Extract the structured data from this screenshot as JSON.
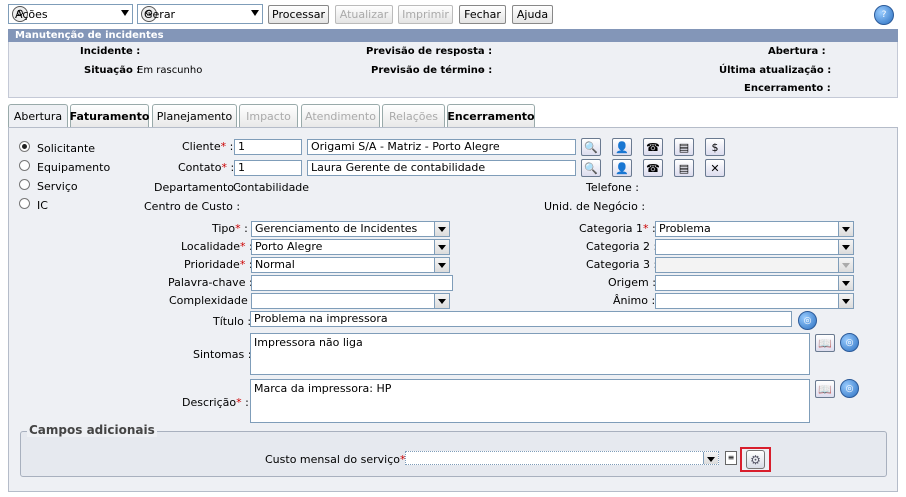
{
  "toolbar": {
    "acoes_label": "Ações",
    "gerar_label": "Gerar",
    "processar_label": "Processar",
    "atualizar_label": "Atualizar",
    "imprimir_label": "Imprimir",
    "fechar_label": "Fechar",
    "ajuda_label": "Ajuda"
  },
  "panel": {
    "title": "Manutenção de incidentes",
    "incidente_label": "Incidente :",
    "situacao_label": "Situação :",
    "situacao_value": "Em rascunho",
    "previsao_resposta_label": "Previsão de resposta :",
    "previsao_resposta_value": "-",
    "previsao_termino_label": "Previsão de término :",
    "previsao_termino_value": "-",
    "abertura_label": "Abertura :",
    "ultima_atualizacao_label": "Última atualização :",
    "encerramento_label": "Encerramento :"
  },
  "tabs": [
    {
      "label": "Abertura"
    },
    {
      "label": "Faturamento"
    },
    {
      "label": "Planejamento"
    },
    {
      "label": "Impacto"
    },
    {
      "label": "Atendimento"
    },
    {
      "label": "Relações"
    },
    {
      "label": "Encerramento"
    }
  ],
  "radios": [
    {
      "label": "Solicitante"
    },
    {
      "label": "Equipamento"
    },
    {
      "label": "Serviço"
    },
    {
      "label": "IC"
    }
  ],
  "form": {
    "cliente_label": "Cliente",
    "cliente_code": "1",
    "cliente_name": "Origami S/A - Matriz - Porto Alegre",
    "contato_label": "Contato",
    "contato_code": "1",
    "contato_name": "Laura Gerente de contabilidade",
    "departamento_label": "Departamento :",
    "departamento_value": "Contabilidade",
    "centro_custo_label": "Centro de Custo :",
    "telefone_label": "Telefone :",
    "unid_negocio_label": "Unid. de Negócio :",
    "tipo_label": "Tipo",
    "tipo_value": "Gerenciamento de Incidentes",
    "localidade_label": "Localidade",
    "localidade_value": "Porto Alegre",
    "prioridade_label": "Prioridade",
    "prioridade_value": "Normal",
    "palavra_chave_label": "Palavra-chave :",
    "complexidade_label": "Complexidade :",
    "categoria1_label": "Categoria 1",
    "categoria1_value": "Problema",
    "categoria2_label": "Categoria 2 :",
    "categoria3_label": "Categoria 3 :",
    "origem_label": "Origem :",
    "animo_label": "Ânimo :",
    "titulo_label": "Título :",
    "titulo_value": "Problema na impressora",
    "sintomas_label": "Sintomas :",
    "sintomas_value": "Impressora não liga",
    "descricao_label": "Descrição",
    "descricao_value": "Marca da impressora: HP",
    "req_mark": "*",
    "colon": ":"
  },
  "extra": {
    "legend": "Campos adicionais",
    "custo_label": "Custo mensal do serviço",
    "custo_value": ""
  },
  "colors": {
    "panel_header": "#8396b8",
    "panel_bg": "#eef0f4",
    "required": "#cc0000",
    "highlight_border": "#d81e2c"
  }
}
